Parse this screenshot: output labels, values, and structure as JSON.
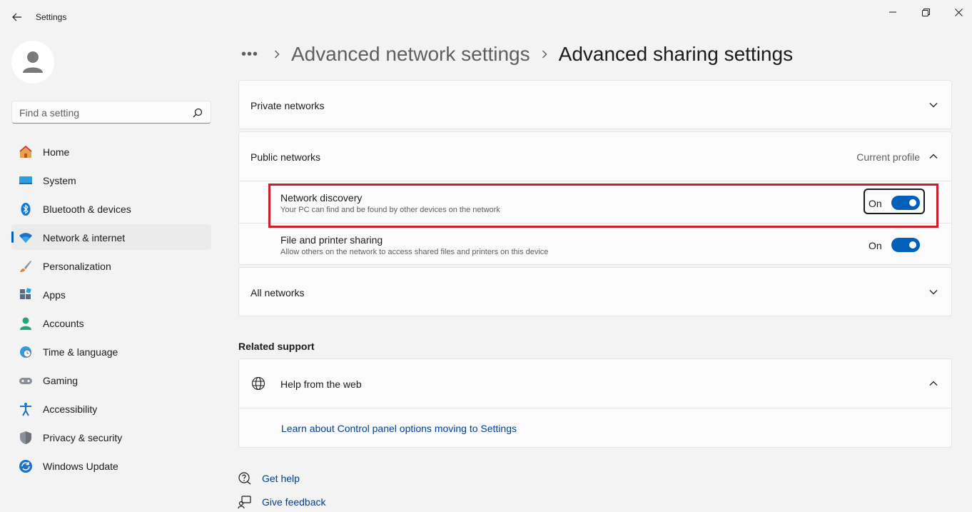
{
  "window": {
    "title": "Settings"
  },
  "sidebar": {
    "search_placeholder": "Find a setting",
    "items": [
      {
        "label": "Home",
        "icon": "home-icon"
      },
      {
        "label": "System",
        "icon": "system-icon"
      },
      {
        "label": "Bluetooth & devices",
        "icon": "bluetooth-icon"
      },
      {
        "label": "Network & internet",
        "icon": "wifi-icon",
        "active": true
      },
      {
        "label": "Personalization",
        "icon": "brush-icon"
      },
      {
        "label": "Apps",
        "icon": "apps-icon"
      },
      {
        "label": "Accounts",
        "icon": "person-icon"
      },
      {
        "label": "Time & language",
        "icon": "clock-globe-icon"
      },
      {
        "label": "Gaming",
        "icon": "gamepad-icon"
      },
      {
        "label": "Accessibility",
        "icon": "accessibility-icon"
      },
      {
        "label": "Privacy & security",
        "icon": "shield-icon"
      },
      {
        "label": "Windows Update",
        "icon": "update-icon"
      }
    ]
  },
  "breadcrumb": {
    "ellipsis": "•••",
    "parent": "Advanced network settings",
    "current": "Advanced sharing settings"
  },
  "private_networks": {
    "title": "Private networks"
  },
  "public_networks": {
    "title": "Public networks",
    "status": "Current profile",
    "settings": [
      {
        "title": "Network discovery",
        "description": "Your PC can find and be found by other devices on the network",
        "toggle_label": "On",
        "toggle_on": true
      },
      {
        "title": "File and printer sharing",
        "description": "Allow others on the network to access shared files and printers on this device",
        "toggle_label": "On",
        "toggle_on": true
      }
    ]
  },
  "all_networks": {
    "title": "All networks"
  },
  "related_support": {
    "heading": "Related support",
    "help_title": "Help from the web",
    "link": "Learn about Control panel options moving to Settings"
  },
  "footer": {
    "get_help": "Get help",
    "give_feedback": "Give feedback"
  },
  "colors": {
    "accent": "#005fb8",
    "highlight": "#c8202e",
    "link": "#003e92"
  }
}
